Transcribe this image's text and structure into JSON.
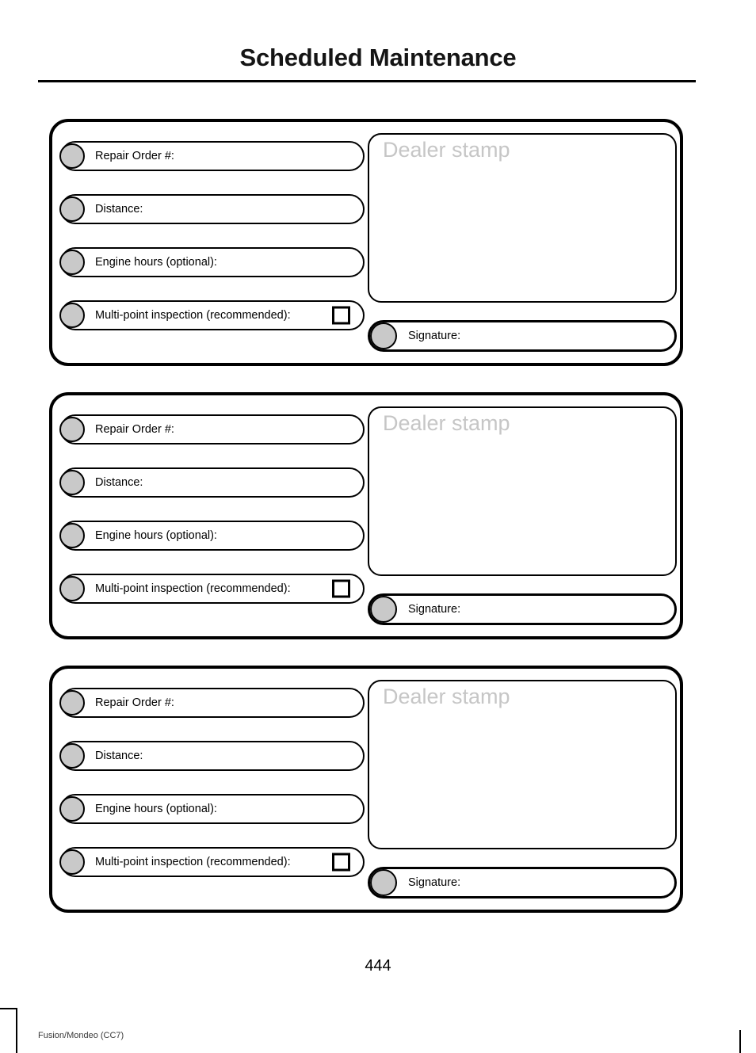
{
  "page": {
    "title": "Scheduled Maintenance",
    "page_number": "444",
    "footer_note": "Fusion/Mondeo (CC7)"
  },
  "colors": {
    "bullet_fill": "#c9c9c9",
    "stamp_text": "#c6c6c6",
    "border": "#000000",
    "background": "#ffffff"
  },
  "labels": {
    "repair_order": "Repair Order #:",
    "distance": "Distance:",
    "engine_hours": "Engine hours (optional):",
    "multi_point": "Multi-point inspection (recommended):",
    "dealer_stamp": "Dealer stamp",
    "signature": "Signature:"
  },
  "cards": [
    {
      "fields": [
        {
          "label": "Repair Order #:",
          "has_checkbox": false
        },
        {
          "label": "Distance:",
          "has_checkbox": false
        },
        {
          "label": "Engine hours (optional):",
          "has_checkbox": false
        },
        {
          "label": "Multi-point inspection (recommended):",
          "has_checkbox": true
        }
      ],
      "stamp_label": "Dealer stamp",
      "signature_label": "Signature:"
    },
    {
      "fields": [
        {
          "label": "Repair Order #:",
          "has_checkbox": false
        },
        {
          "label": "Distance:",
          "has_checkbox": false
        },
        {
          "label": "Engine hours (optional):",
          "has_checkbox": false
        },
        {
          "label": "Multi-point inspection (recommended):",
          "has_checkbox": true
        }
      ],
      "stamp_label": "Dealer stamp",
      "signature_label": "Signature:"
    },
    {
      "fields": [
        {
          "label": "Repair Order #:",
          "has_checkbox": false
        },
        {
          "label": "Distance:",
          "has_checkbox": false
        },
        {
          "label": "Engine hours (optional):",
          "has_checkbox": false
        },
        {
          "label": "Multi-point inspection (recommended):",
          "has_checkbox": true
        }
      ],
      "stamp_label": "Dealer stamp",
      "signature_label": "Signature:"
    }
  ]
}
